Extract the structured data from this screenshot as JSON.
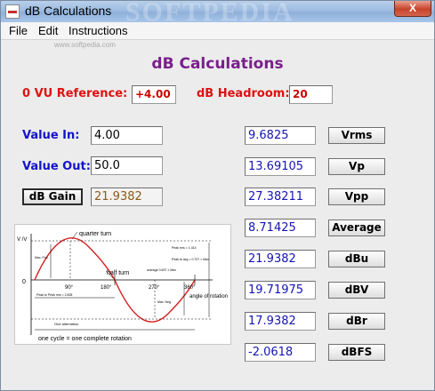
{
  "window": {
    "title": "dB Calculations",
    "watermark": "SOFTPEDIA",
    "close_label": "X"
  },
  "menu": {
    "items": [
      "File",
      "Edit",
      "Instructions"
    ],
    "subtext": "www.softpedia.com"
  },
  "main": {
    "heading": "dB Calculations"
  },
  "reference": {
    "vu_label": "0 VU Reference:",
    "vu_value": "+4.00",
    "headroom_label": "dB Headroom:",
    "headroom_value": "20"
  },
  "inputs": {
    "value_in_label": "Value In:",
    "value_in": "4.00",
    "value_out_label": "Value Out:",
    "value_out": "50.0",
    "gain_button": "dB Gain",
    "gain_value": "21.9382"
  },
  "results": [
    {
      "value": "9.6825",
      "button": "Vrms"
    },
    {
      "value": "13.69105",
      "button": "Vp"
    },
    {
      "value": "27.38211",
      "button": "Vpp"
    },
    {
      "value": "8.71425",
      "button": "Average"
    },
    {
      "value": "21.9382",
      "button": "dBu"
    },
    {
      "value": "19.71975",
      "button": "dBV"
    },
    {
      "value": "17.9382",
      "button": "dBr"
    },
    {
      "value": "-2.0618",
      "button": "dBFS"
    }
  ],
  "diagram": {
    "y_axis": "V /V",
    "quarter_turn": "quarter turn",
    "half_turn": "half turn",
    "peak_rms": "Peak rms = 1.414",
    "peak_avg": "Peak to avg = 0.707 × Max",
    "average": "average 0.637 × Max",
    "max_pos": "Max. Pos.",
    "max_neg": "Max. Neg.",
    "peak_to_peak": "Peak to Peak rms = 2.828",
    "one_alternation": "One alternation",
    "angle_label": "angle of rotation",
    "deg_0": "0",
    "deg_90": "90°",
    "deg_180": "180°",
    "deg_270": "270°",
    "deg_360": "360°",
    "cycle_caption": "one cycle = one complete rotation"
  }
}
